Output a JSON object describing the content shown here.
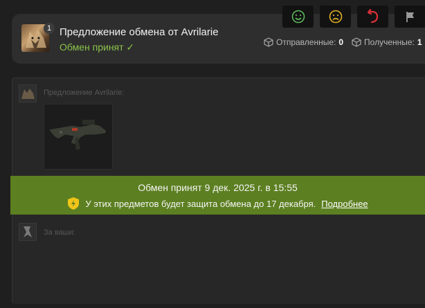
{
  "actions": {
    "smile": "smiley-icon",
    "sad": "sad-icon",
    "undo": "undo-icon",
    "flag": "flag-icon"
  },
  "header": {
    "badge_count": "1",
    "title": "Предложение обмена от Avrilarie",
    "status": "Обмен принят ✓",
    "sent_label": "Отправленные:",
    "sent_count": "0",
    "received_label": "Полученные:",
    "received_count": "1"
  },
  "offer": {
    "partner_label": "Предложение Avrilarie:",
    "yours_label": "За ваши:"
  },
  "banner": {
    "accepted_text": "Обмен принят 9 дек. 2025 г. в 15:55",
    "protection_text": "У этих предметов будет защита обмена до 17 декабря.",
    "more_link": "Подробнее"
  },
  "colors": {
    "accent_green": "#8bc34a",
    "banner_bg": "#5c7f21",
    "shield": "#f0c419"
  }
}
